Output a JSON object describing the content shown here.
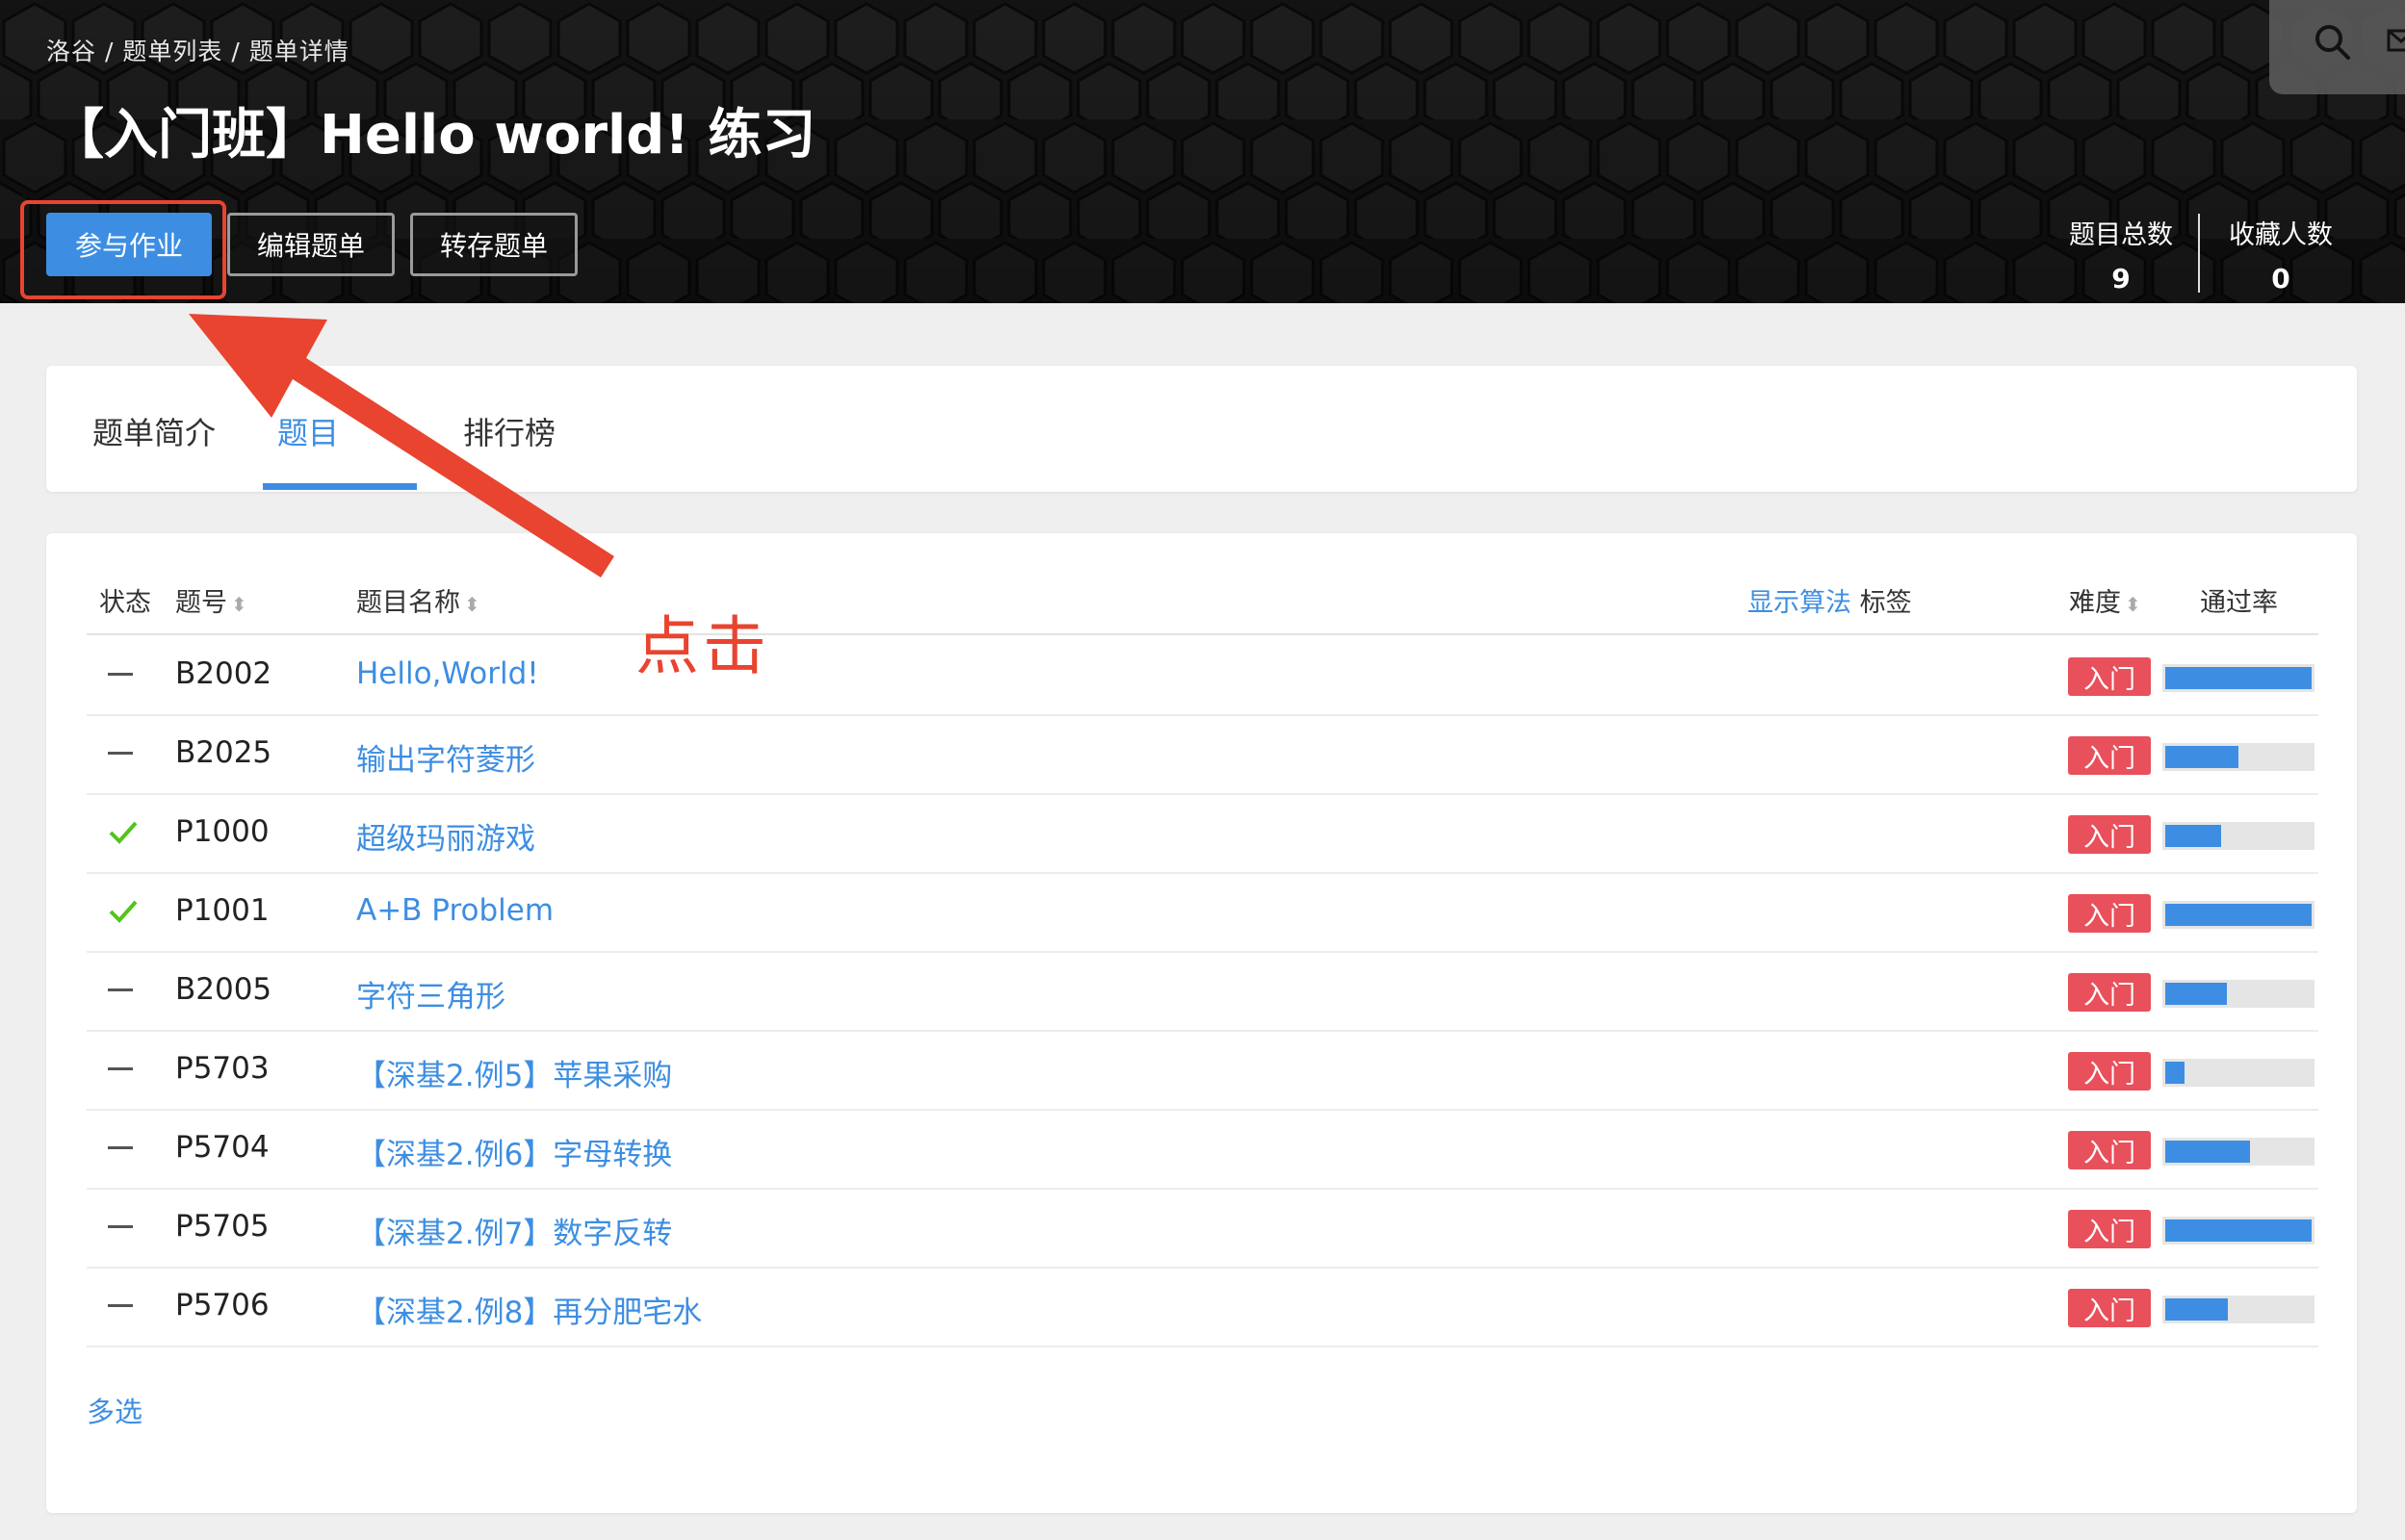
{
  "breadcrumb": {
    "home": "洛谷",
    "list": "题单列表",
    "detail": "题单详情",
    "sep": "/"
  },
  "page_title": "【入门班】Hello world! 练习",
  "buttons": {
    "join": "参与作业",
    "edit": "编辑题单",
    "save": "转存题单"
  },
  "stats": {
    "total_label": "题目总数",
    "total_value": "9",
    "fav_label": "收藏人数",
    "fav_value": "0"
  },
  "tabs": {
    "intro": "题单简介",
    "problems": "题目",
    "rank": "排行榜"
  },
  "table": {
    "headers": {
      "status": "状态",
      "id": "题号",
      "name": "题目名称",
      "show_algo": "显示算法",
      "tags": "标签",
      "difficulty": "难度",
      "pass_rate": "通过率"
    },
    "rows": [
      {
        "status": "unsolved",
        "id": "B2002",
        "name": "Hello,World!",
        "difficulty": "入门",
        "pass_rate": 1.0
      },
      {
        "status": "unsolved",
        "id": "B2025",
        "name": "输出字符菱形",
        "difficulty": "入门",
        "pass_rate": 0.5
      },
      {
        "status": "solved",
        "id": "P1000",
        "name": "超级玛丽游戏",
        "difficulty": "入门",
        "pass_rate": 0.38
      },
      {
        "status": "solved",
        "id": "P1001",
        "name": "A+B Problem",
        "difficulty": "入门",
        "pass_rate": 1.0
      },
      {
        "status": "unsolved",
        "id": "B2005",
        "name": "字符三角形",
        "difficulty": "入门",
        "pass_rate": 0.42
      },
      {
        "status": "unsolved",
        "id": "P5703",
        "name": "【深基2.例5】苹果采购",
        "difficulty": "入门",
        "pass_rate": 0.13
      },
      {
        "status": "unsolved",
        "id": "P5704",
        "name": "【深基2.例6】字母转换",
        "difficulty": "入门",
        "pass_rate": 0.58
      },
      {
        "status": "unsolved",
        "id": "P5705",
        "name": "【深基2.例7】数字反转",
        "difficulty": "入门",
        "pass_rate": 1.0
      },
      {
        "status": "unsolved",
        "id": "P5706",
        "name": "【深基2.例8】再分肥宅水",
        "difficulty": "入门",
        "pass_rate": 0.43
      }
    ]
  },
  "multi_select": "多选",
  "annotation": {
    "label": "点击"
  },
  "colors": {
    "accent": "#3d8ee2",
    "badge": "#e8505b",
    "annotation": "#e8442f",
    "solved": "#52c41a"
  },
  "icons": {
    "search": "search-icon",
    "mail": "mail-icon",
    "sort": "sort-icon",
    "check": "check-icon",
    "dash": "dash-icon"
  }
}
